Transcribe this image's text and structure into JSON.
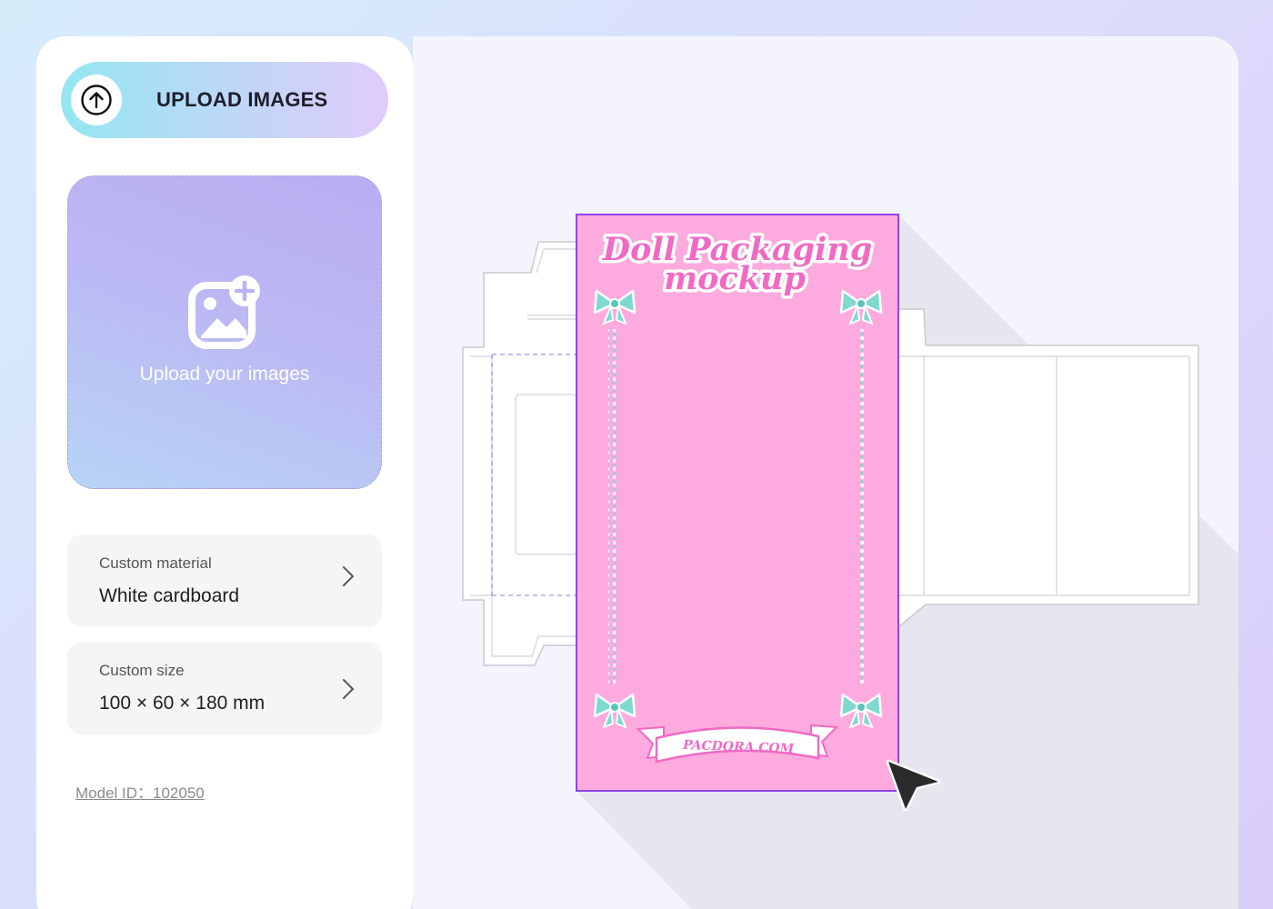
{
  "upload": {
    "button_label": "UPLOAD IMAGES",
    "icon": "arrow-up-circle-icon"
  },
  "dropzone": {
    "text": "Upload your images",
    "icon": "image-add-icon"
  },
  "options": [
    {
      "label": "Custom material",
      "value": "White cardboard"
    },
    {
      "label": "Custom size",
      "value": "100 × 60 × 180 mm"
    }
  ],
  "model": {
    "text": "Model ID：102050"
  },
  "design": {
    "title_line1": "Doll Packaging",
    "title_line2": "mockup",
    "banner_text": "PACDORA.COM",
    "panel_color": "#fdaadf",
    "title_color": "#f06ac4",
    "bow_color": "#7fd9d1",
    "outline_color": "#8b46e6"
  }
}
